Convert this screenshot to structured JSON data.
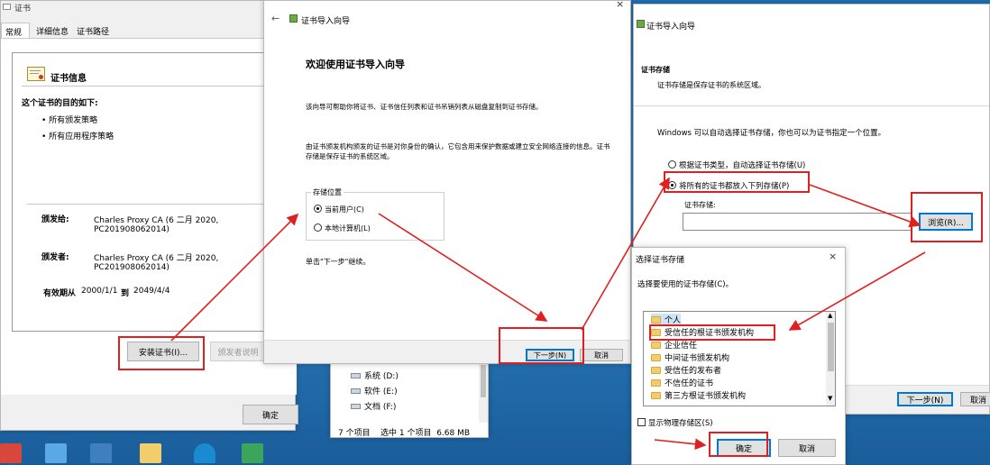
{
  "cert_window": {
    "title": "证书",
    "tabs": [
      "常规",
      "详细信息",
      "证书路径"
    ],
    "info_heading": "证书信息",
    "purpose_heading": "这个证书的目的如下:",
    "purposes": [
      "• 所有颁发策略",
      "• 所有应用程序策略"
    ],
    "issued_to_label": "颁发给:",
    "issued_to_value": [
      "Charles Proxy CA (6 二月 2020,",
      "PC201908062014)"
    ],
    "issued_by_label": "颁发者:",
    "issued_by_value": [
      "Charles Proxy CA (6 二月 2020,",
      "PC201908062014)"
    ],
    "valid_label": "有效期从",
    "valid_from": "2000/1/1",
    "valid_to_word": "到",
    "valid_to": "2049/4/4",
    "install_button": "安装证书(I)...",
    "issuer_statement_button": "颁发者说明",
    "ok_button": "确定"
  },
  "wizard1": {
    "title": "证书导入向导",
    "heading": "欢迎使用证书导入向导",
    "para1": "该向导可帮助你将证书、证书信任列表和证书吊销列表从磁盘复制到证书存储。",
    "para2": "由证书颁发机构颁发的证书是对你身份的确认，它包含用来保护数据或建立安全网络连接的信息。证书存储是保存证书的系统区域。",
    "store_location_label": "存储位置",
    "current_user": "当前用户(C)",
    "local_machine": "本地计算机(L)",
    "continue_hint": "单击\"下一步\"继续。",
    "next_button": "下一步(N)",
    "cancel_button": "取消"
  },
  "explorer": {
    "drives": [
      "系统 (D:)",
      "软件 (E:)",
      "文档 (F:)"
    ],
    "status": "7 个项目    选中 1 个项目  6.68 MB"
  },
  "wizard2": {
    "title": "证书导入向导",
    "section_title": "证书存储",
    "section_desc": "证书存储是保存证书的系统区域。",
    "auto_text": "Windows 可以自动选择证书存储，你也可以为证书指定一个位置。",
    "option_auto": "根据证书类型，自动选择证书存储(U)",
    "option_all": "将所有的证书都放入下列存储(P)",
    "store_label": "证书存储:",
    "browse_button": "浏览(R)...",
    "next_button": "下一步(N)",
    "cancel_button": "取消"
  },
  "select_store": {
    "title": "选择证书存储",
    "prompt": "选择要使用的证书存储(C)。",
    "items": [
      "个人",
      "受信任的根证书颁发机构",
      "企业信任",
      "中间证书颁发机构",
      "受信任的发布者",
      "不信任的证书",
      "第三方根证书颁发机构"
    ],
    "show_physical": "显示物理存储区(S)",
    "ok_button": "确定",
    "cancel_button": "取消"
  },
  "colors": {
    "annotation_red": "#e02020",
    "selection_blue": "#0078d7",
    "desktop_blue": "#2f86c8"
  }
}
